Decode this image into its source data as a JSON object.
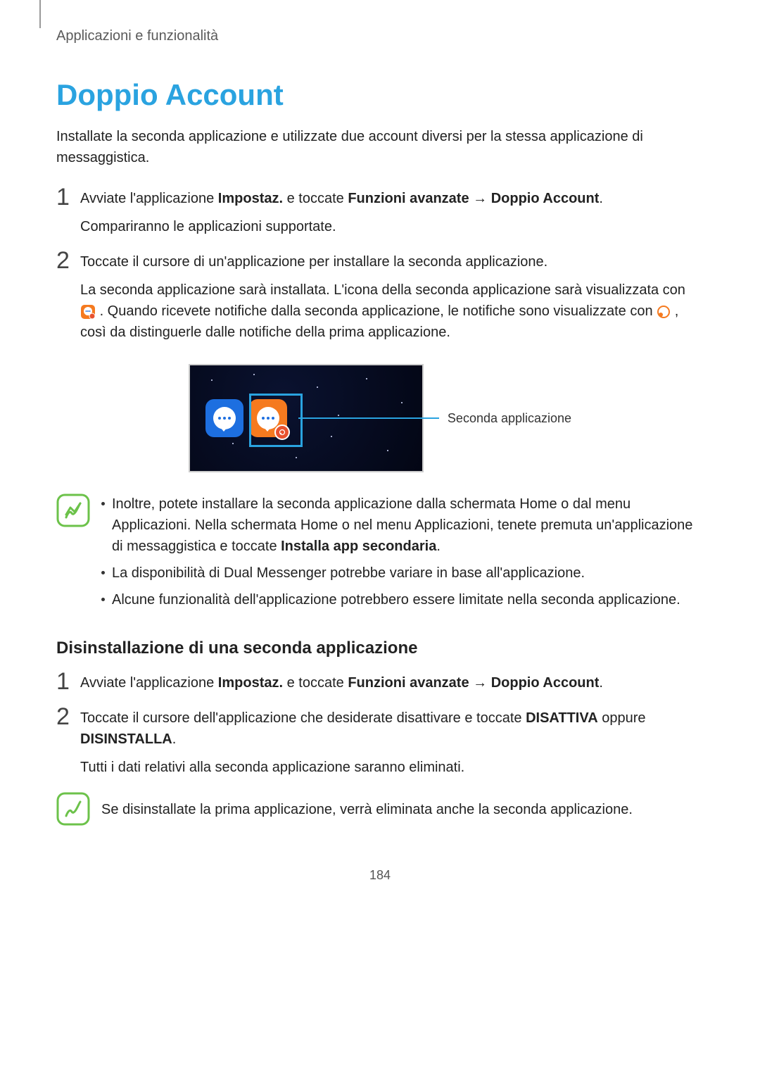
{
  "breadcrumb": "Applicazioni e funzionalità",
  "title": "Doppio Account",
  "intro": "Installate la seconda applicazione e utilizzate due account diversi per la stessa applicazione di messaggistica.",
  "steps": [
    {
      "num": "1",
      "parts": {
        "a": "Avviate l'applicazione ",
        "b": "Impostaz.",
        "c": " e toccate ",
        "d": "Funzioni avanzate",
        "e": " → ",
        "f": "Doppio Account",
        "g": "."
      },
      "sub": "Compariranno le applicazioni supportate."
    },
    {
      "num": "2",
      "line1": "Toccate il cursore di un'applicazione per installare la seconda applicazione.",
      "line2a": "La seconda applicazione sarà installata. L'icona della seconda applicazione sarà visualizzata con ",
      "line2b": ". Quando ricevete notifiche dalla seconda applicazione, le notifiche sono visualizzate con ",
      "line2c": ", così da distinguerle dalle notifiche della prima applicazione."
    }
  ],
  "callout": "Seconda applicazione",
  "notes": [
    {
      "a": "Inoltre, potete installare la seconda applicazione dalla schermata Home o dal menu Applicazioni. Nella schermata Home o nel menu Applicazioni, tenete premuta un'applicazione di messaggistica e toccate ",
      "b": "Installa app secondaria",
      "c": "."
    },
    {
      "text": "La disponibilità di Dual Messenger potrebbe variare in base all'applicazione."
    },
    {
      "text": "Alcune funzionalità dell'applicazione potrebbero essere limitate nella seconda applicazione."
    }
  ],
  "subheading": "Disinstallazione di una seconda applicazione",
  "uninstall_steps": [
    {
      "num": "1",
      "parts": {
        "a": "Avviate l'applicazione ",
        "b": "Impostaz.",
        "c": " e toccate ",
        "d": "Funzioni avanzate",
        "e": " → ",
        "f": "Doppio Account",
        "g": "."
      }
    },
    {
      "num": "2",
      "line_a": "Toccate il cursore dell'applicazione che desiderate disattivare e toccate ",
      "line_b": "DISATTIVA",
      "line_c": " oppure ",
      "line_d": "DISINSTALLA",
      "line_e": ".",
      "sub": "Tutti i dati relativi alla seconda applicazione saranno eliminati."
    }
  ],
  "final_note": "Se disinstallate la prima applicazione, verrà eliminata anche la seconda applicazione.",
  "page_number": "184"
}
